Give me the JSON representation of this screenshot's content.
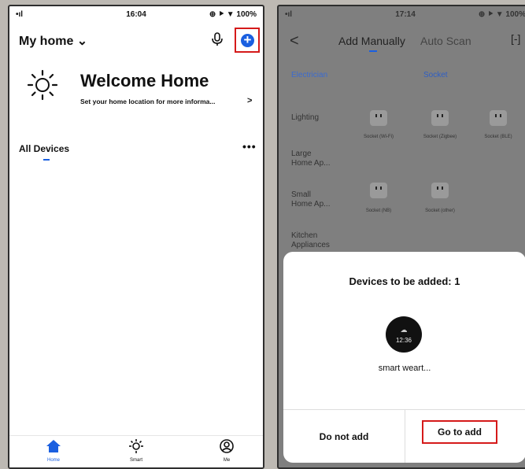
{
  "left": {
    "status": {
      "signal": "•ıl",
      "time": "16:04",
      "battery": "⊕ ⯈ ▼ 100%"
    },
    "header": {
      "title": "My home",
      "dropdown": "⌄"
    },
    "welcome": {
      "title": "Welcome Home",
      "subtitle": "Set your home location for more informa...",
      "arrow": ">"
    },
    "devices": {
      "tab": "All Devices",
      "more": "•••"
    },
    "nav": [
      {
        "label": "Home"
      },
      {
        "label": "Smart"
      },
      {
        "label": "Me"
      }
    ],
    "colors": {
      "accent": "#1a5fe0",
      "highlight": "#d51a1a"
    }
  },
  "right": {
    "status": {
      "signal": "•ıl",
      "time": "17:14",
      "battery": "⊕ ⯈ ▼ 100%"
    },
    "header": {
      "back": "<",
      "tab_manual": "Add Manually",
      "tab_auto": "Auto Scan",
      "scan": "[-]"
    },
    "categories": [
      "Electrician",
      "Lighting",
      "Large Home Ap...",
      "Small Home Ap...",
      "Kitchen Appliances"
    ],
    "grid_header": "Socket",
    "sockets": [
      {
        "label": "Socket (Wi-Fi)"
      },
      {
        "label": "Socket (Zigbee)"
      },
      {
        "label": "Socket (BLE)"
      },
      {
        "label": "Socket (NB)"
      },
      {
        "label": "Socket (other)"
      }
    ],
    "modal": {
      "title": "Devices to be added: 1",
      "device_time": "12:36",
      "device_name": "smart weart...",
      "cancel": "Do not add",
      "confirm": "Go to add"
    }
  }
}
